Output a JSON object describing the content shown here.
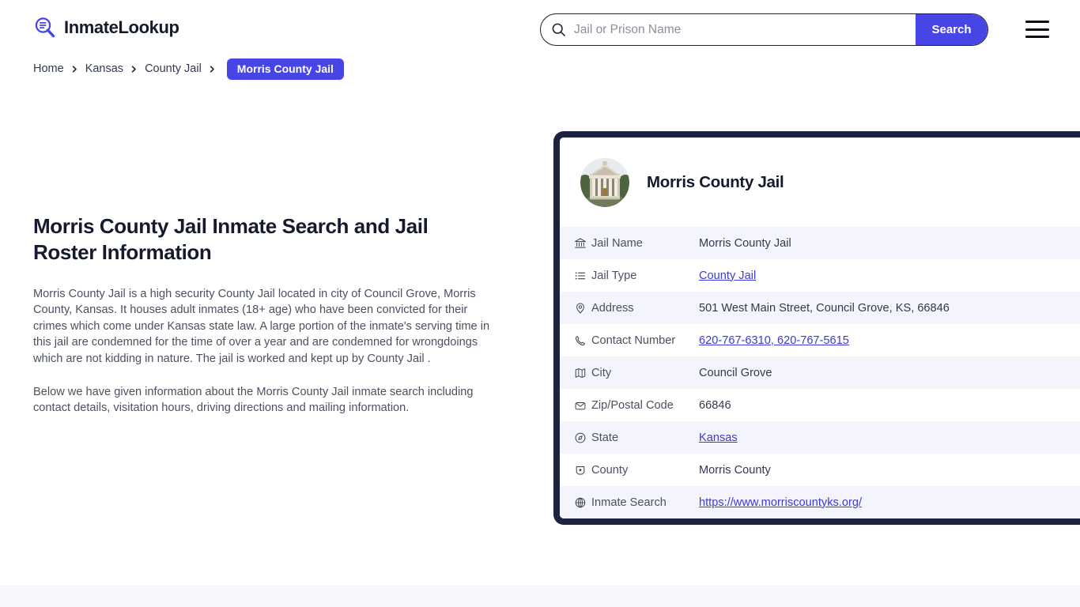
{
  "header": {
    "brand_name": "InmateLookup",
    "brand_icon": "magnifier-list-icon",
    "menu_icon": "hamburger-menu-icon",
    "search": {
      "icon": "search-icon",
      "placeholder": "Jail or Prison Name",
      "value": "",
      "button_label": "Search"
    }
  },
  "breadcrumb": {
    "items": [
      {
        "label": "Home"
      },
      {
        "label": "Kansas"
      },
      {
        "label": "County Jail"
      }
    ],
    "separator": "›",
    "current": "Morris County Jail"
  },
  "main": {
    "title": "Morris County Jail Inmate Search and Jail Roster Information",
    "paragraphs": [
      "Morris County Jail is a high security County Jail located in city of Council Grove, Morris County, Kansas. It houses adult inmates (18+ age) who have been convicted for their crimes which come under Kansas state law. A large portion of the inmate's serving time in this jail are condemned for the time of over a year and are condemned for wrongdoings which are not kidding in nature. The jail is worked and kept up by County Jail .",
      "Below we have given information about the Morris County Jail inmate search including contact details, visitation hours, driving directions and mailing information."
    ]
  },
  "card": {
    "avatar_icon": "courthouse-photo",
    "title": "Morris County Jail",
    "rows": [
      {
        "icon": "bank-icon",
        "label": "Jail Name",
        "value": "Morris County Jail",
        "link": false
      },
      {
        "icon": "list-icon",
        "label": "Jail Type",
        "value": "County Jail",
        "link": true
      },
      {
        "icon": "map-pin-icon",
        "label": "Address",
        "value": "501 West Main Street, Council Grove, KS, 66846",
        "link": false
      },
      {
        "icon": "phone-icon",
        "label": "Contact Number",
        "value": "620-767-6310, 620-767-5615",
        "link": true
      },
      {
        "icon": "map-icon",
        "label": "City",
        "value": "Council Grove",
        "link": false
      },
      {
        "icon": "envelope-icon",
        "label": "Zip/Postal Code",
        "value": "66846",
        "link": false
      },
      {
        "icon": "compass-icon",
        "label": "State",
        "value": "Kansas",
        "link": true
      },
      {
        "icon": "region-map-icon",
        "label": "County",
        "value": "Morris County",
        "link": false
      },
      {
        "icon": "globe-icon",
        "label": "Inmate Search",
        "value": "https://www.morriscountyks.org/",
        "link": true
      }
    ]
  },
  "colors": {
    "accent": "#4745e5",
    "card_border": "#1b2340",
    "row_alt": "#f4f5fc",
    "link": "#3d3ad6",
    "heading": "#161a2e",
    "body_text": "#4b5160",
    "bottom_band": "#f6f6fd"
  }
}
